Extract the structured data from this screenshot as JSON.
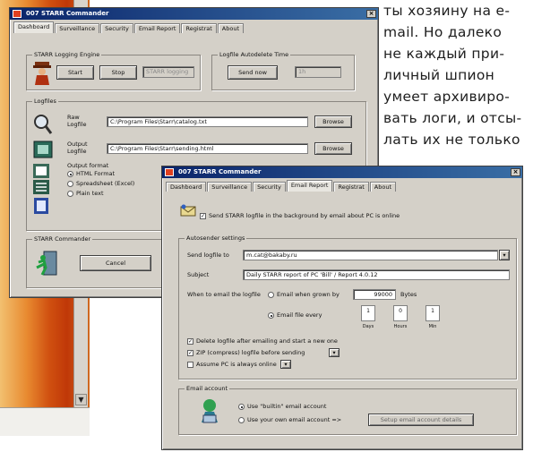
{
  "article_text": {
    "lines": [
      "ты хозяину на e-",
      "mail. Но далеко",
      "не каждый при-",
      "личный шпион",
      "умеет архивиро-",
      "вать логи, и отсы-",
      "лать их не только"
    ]
  },
  "back_window": {
    "title": "007 STARR Commander",
    "tabs": [
      "Dashboard",
      "Surveillance",
      "Security",
      "Email Report",
      "Registrat",
      "About"
    ],
    "active_tab": 0,
    "logging_group": "STARR Logging Engine",
    "start_button": "Start",
    "stop_button": "Stop",
    "engine_status": "STARR logging",
    "autodelete_group": "Logfile Autodelete Time",
    "send_now_button": "Send now",
    "autodelete_value": "1h",
    "logfiles_group": "Logfiles",
    "raw_logfile_label": "Raw\nLogfile",
    "raw_logfile_value": "C:\\Program Files\\Starr\\catalog.txt",
    "output_logfile_label": "Output\nLogfile",
    "output_logfile_value": "C:\\Program Files\\Starr\\sending.html",
    "browse_button": "Browse",
    "output_format_label": "Output format",
    "format_options": [
      "HTML Format",
      "Spreadsheet (Excel)",
      "Plain text"
    ],
    "format_selected": 0,
    "commander_group": "STARR Commander",
    "cancel_button": "Cancel"
  },
  "front_window": {
    "title": "007 STARR Commander",
    "tabs": [
      "Dashboard",
      "Surveillance",
      "Security",
      "Email Report",
      "Registrat",
      "About"
    ],
    "active_tab": 3,
    "send_logfile_checkbox": "Send STARR logfile in the background by email about PC is online",
    "send_logfile_checked": true,
    "autosender_group": "Autosender settings",
    "send_to_label": "Send logfile to",
    "send_to_value": "m.cat@bakaby.ru",
    "subject_label": "Subject",
    "subject_value": "Daily STARR report of PC 'Bill' / Report 4.0.12",
    "when_label": "When to email the logfile",
    "radio_size": "Email when grown by",
    "size_value": "99000",
    "size_unit": "Bytes",
    "radio_time": "Email file every",
    "radio_selected": 1,
    "time_values": [
      "1",
      "0",
      "1"
    ],
    "time_units": [
      "Days",
      "Hours",
      "Min"
    ],
    "delete_after_label": "Delete logfile after emailing and start a new one",
    "delete_after_checked": true,
    "zip_label": "ZIP (compress) logfile before sending",
    "zip_checked": true,
    "online_label": "Assume PC is always online",
    "online_checked": false,
    "email_account_group": "Email account",
    "use_builtin_label": "Use \"builtin\" email account",
    "use_own_label": "Use your own email account =>",
    "account_selected": 0,
    "setup_button": "Setup email account details"
  },
  "colors": {
    "title_start": "#0a246a",
    "title_end": "#3a6ea5",
    "window_bg": "#d4d0c8"
  }
}
